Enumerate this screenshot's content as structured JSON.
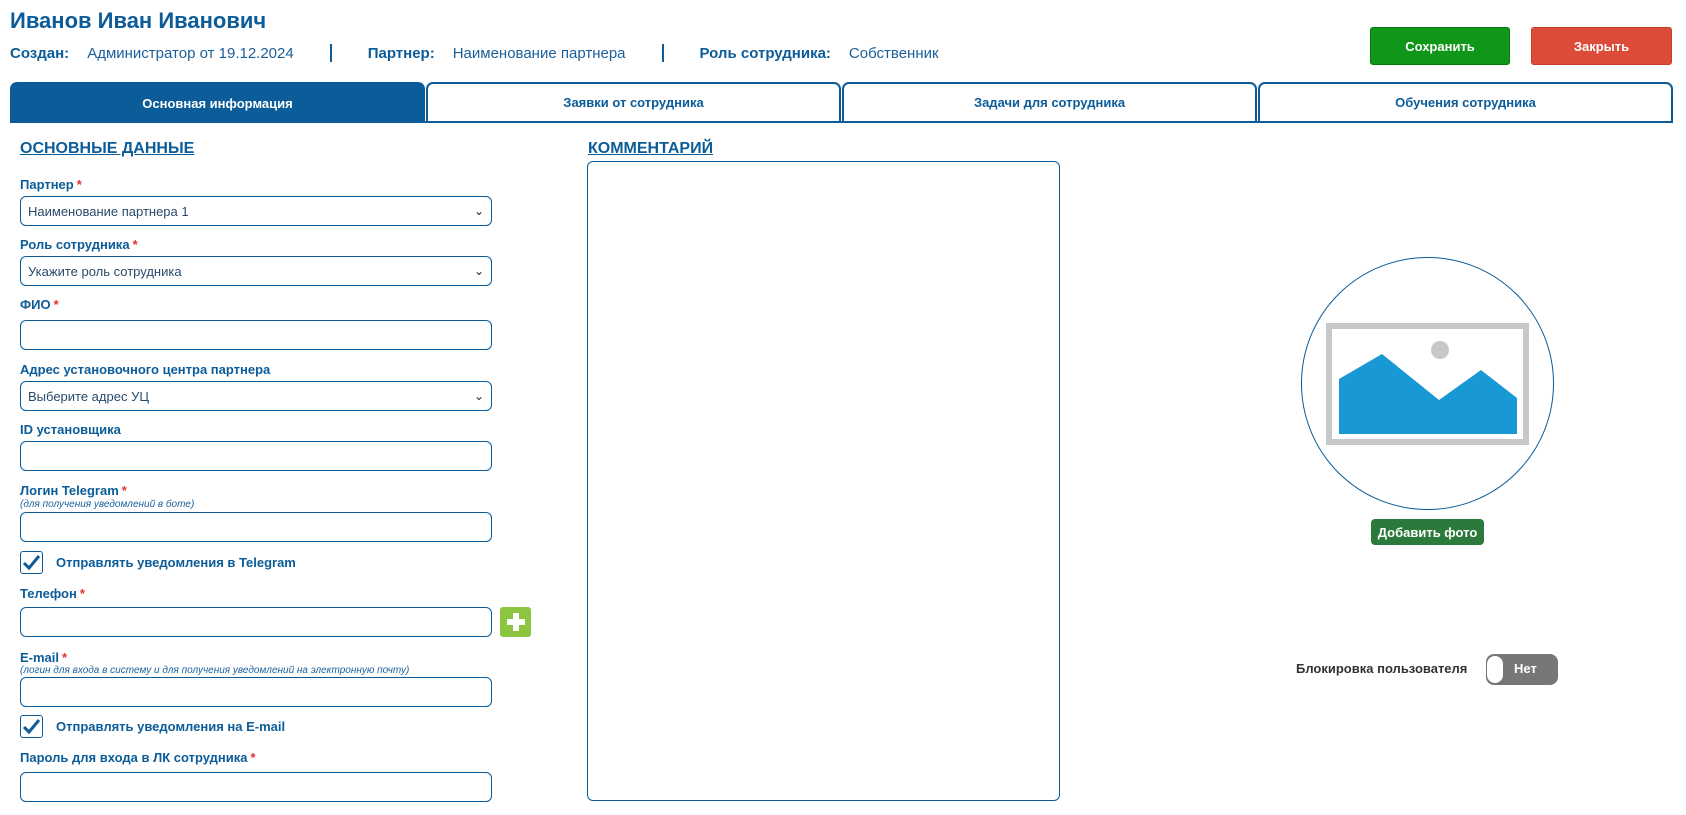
{
  "header": {
    "title": "Иванов Иван Иванович",
    "created_label": "Создан:",
    "created_value": "Администратор от 19.12.2024",
    "partner_label": "Партнер:",
    "partner_value": "Наименование партнера",
    "role_label": "Роль сотрудника:",
    "role_value": "Собственник",
    "save_label": "Сохранить",
    "close_label": "Закрыть"
  },
  "tabs": [
    {
      "label": "Основная информация",
      "active": true
    },
    {
      "label": "Заявки от сотрудника",
      "active": false
    },
    {
      "label": "Задачи для сотрудника",
      "active": false
    },
    {
      "label": "Обучения сотрудника",
      "active": false
    }
  ],
  "main_data": {
    "section_title": "ОСНОВНЫЕ ДАННЫЕ",
    "partner": {
      "label": "Партнер",
      "required_mark": "*",
      "value": "Наименование партнера 1"
    },
    "role": {
      "label": "Роль сотрудника",
      "required_mark": "*",
      "value": "Укажите роль сотрудника"
    },
    "fio": {
      "label": "ФИО",
      "required_mark": "*",
      "value": ""
    },
    "address": {
      "label": "Адрес установочного центра партнера",
      "value": "Выберите адрес УЦ"
    },
    "installer_id": {
      "label": "ID установщика",
      "value": ""
    },
    "telegram": {
      "label": "Логин Telegram",
      "required_mark": "*",
      "hint": "(для получения уведомлений в боте)",
      "value": ""
    },
    "telegram_notify": {
      "label": "Отправлять уведомления в Telegram",
      "checked": true
    },
    "phone": {
      "label": "Телефон",
      "required_mark": "*",
      "value": ""
    },
    "email": {
      "label": "E-mail",
      "required_mark": "*",
      "hint": "(логин для входа в систему и для получения уведомлений на электронную почту)",
      "value": ""
    },
    "email_notify": {
      "label": "Отправлять уведомления на E-mail",
      "checked": true
    },
    "password": {
      "label": "Пароль для входа в ЛК сотрудника",
      "required_mark": "*",
      "value": ""
    }
  },
  "comment": {
    "section_title": "КОММЕНТАРИЙ",
    "value": ""
  },
  "photo": {
    "add_label": "Добавить фото",
    "placeholder_icon": "image-placeholder-icon"
  },
  "block_user": {
    "label": "Блокировка пользователя",
    "toggle_label": "Нет",
    "enabled": false
  },
  "colors": {
    "primary": "#0b5c99",
    "save": "#109618",
    "close": "#dd4b39",
    "required": "#e0312f",
    "add_phone": "#8cc63f",
    "add_photo": "#2b7a3b",
    "toggle_off": "#777777"
  }
}
